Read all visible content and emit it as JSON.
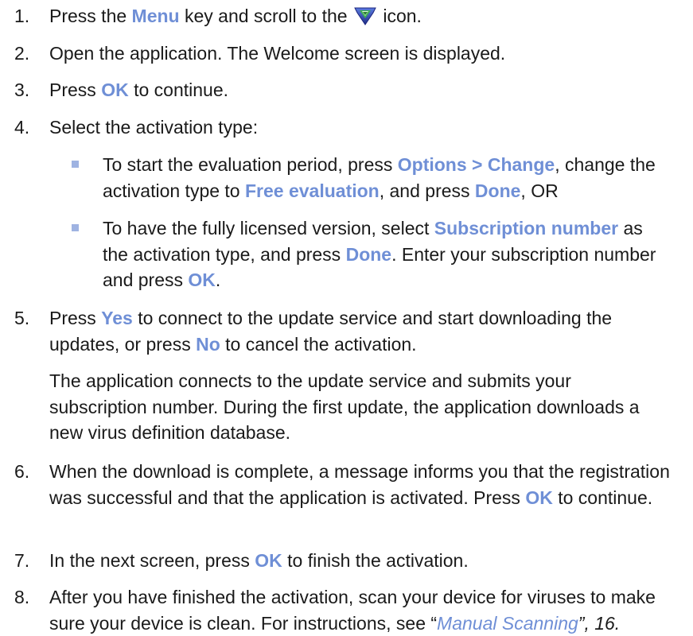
{
  "steps": [
    {
      "number": "1.",
      "p1": "Press the ",
      "k1": "Menu",
      "p2": " key and scroll to the ",
      "icon": "application-shield-icon",
      "p3": " icon."
    },
    {
      "number": "2.",
      "text": "Open the application. The Welcome screen is displayed."
    },
    {
      "number": "3.",
      "p1": "Press ",
      "k1": "OK",
      "p2": " to continue."
    },
    {
      "number": "4.",
      "text": "Select the activation type:",
      "bullets": [
        {
          "p1": "To start the evaluation period, press ",
          "k1": "Options > Change",
          "p2": ", change the activation type to ",
          "k2": "Free evaluation",
          "p3": ", and press ",
          "k3": "Done",
          "p4": ", OR"
        },
        {
          "p1": "To have the fully licensed version, select ",
          "k1": "Subscription number",
          "p2": " as the activation type, and press ",
          "k2": "Done",
          "p3": ". Enter your subscription number and press ",
          "k3": "OK",
          "p4": "."
        }
      ]
    },
    {
      "number": "5.",
      "p1": "Press ",
      "k1": "Yes",
      "p2": " to connect to the update service and start downloading the updates, or press ",
      "k2": "No",
      "p3": " to cancel the activation.",
      "note": "The application connects to the update service and submits your subscription number. During the first update, the application downloads a new virus definition database."
    },
    {
      "number": "6.",
      "p1": "When the download is complete, a message informs you that the registration was successful and that the application is activated. Press ",
      "k1": "OK",
      "p2": " to continue."
    },
    {
      "number": "7.",
      "p1": "In the next screen, press ",
      "k1": "OK",
      "p2": " to finish the activation."
    },
    {
      "number": "8.",
      "p1": "After you have finished the activation, scan your device for viruses to make sure your device is clean. For instructions, see “",
      "link": "Manual Scanning",
      "p2": "”, 16."
    }
  ],
  "colors": {
    "keyword": "#6f8fd6",
    "bullet": "#9fb3e2",
    "text": "#1a1a1a"
  }
}
